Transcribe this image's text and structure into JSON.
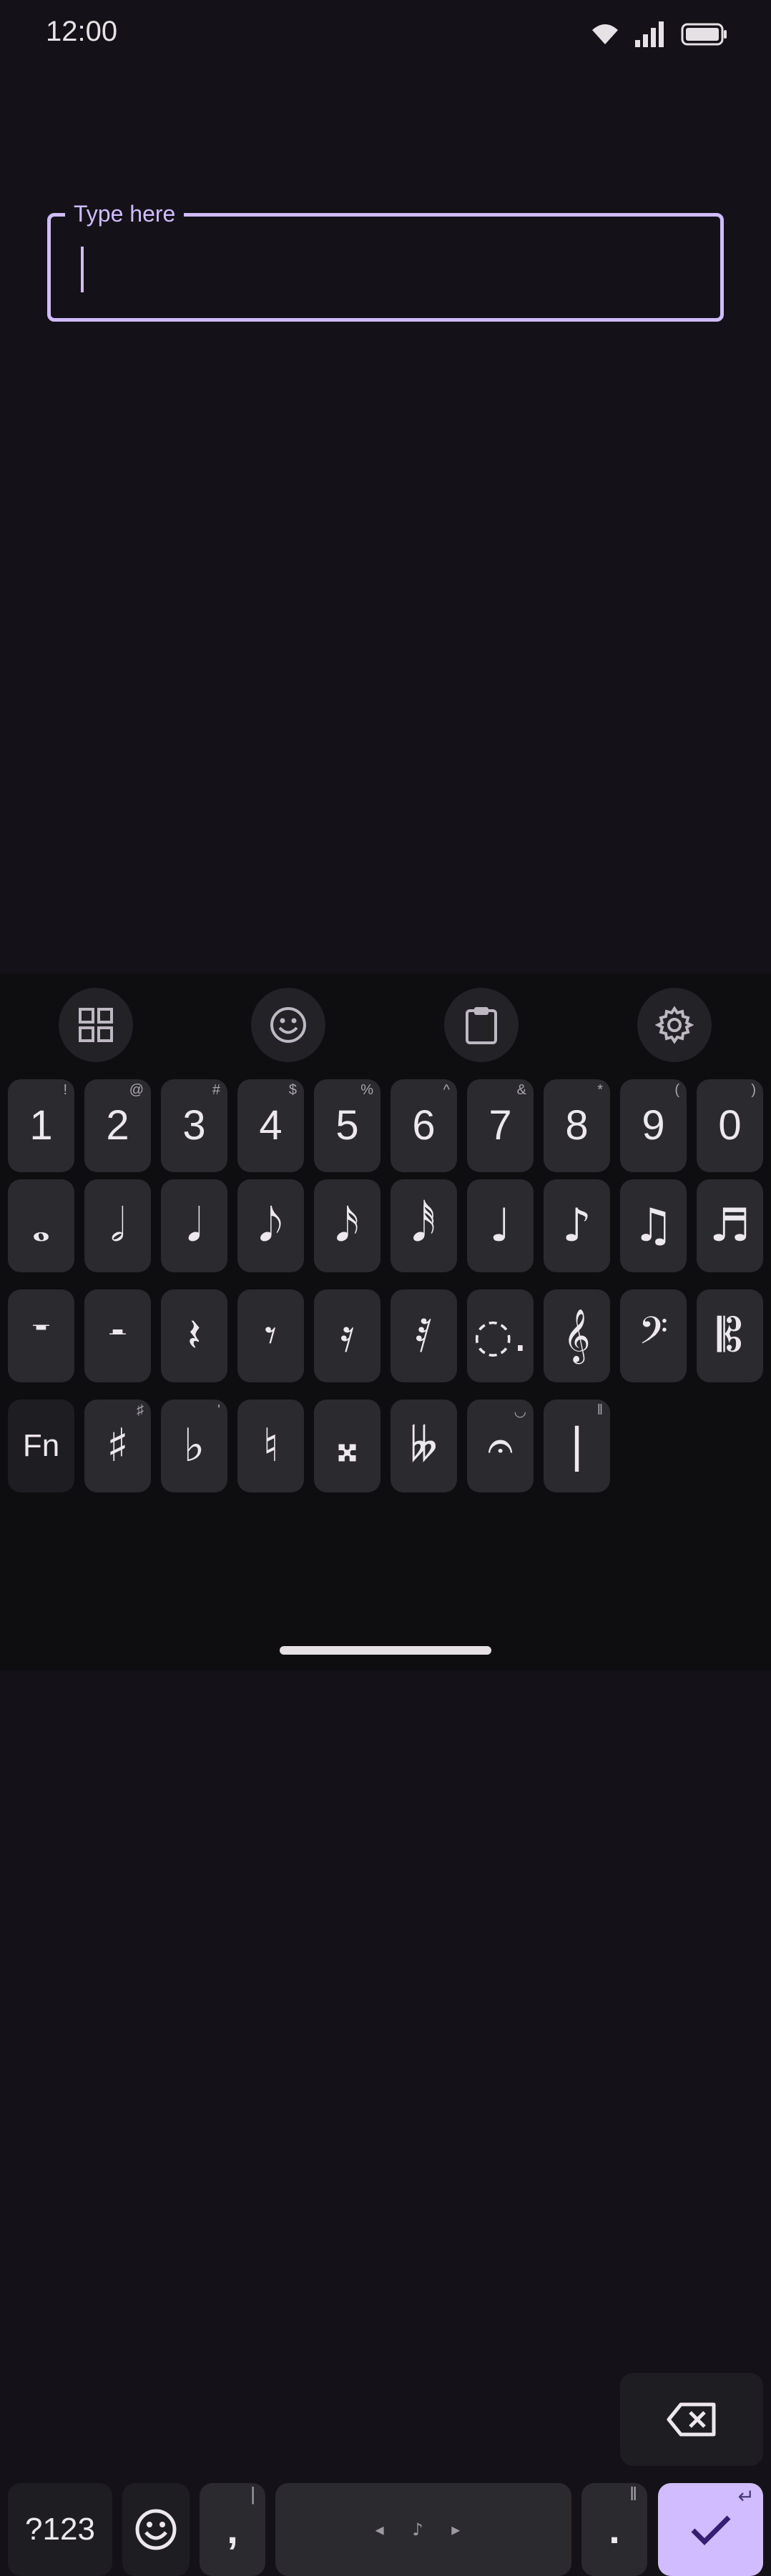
{
  "status_bar": {
    "time": "12:00"
  },
  "text_field": {
    "label": "Type here",
    "value": ""
  },
  "toolbar": [
    {
      "name": "apps-grid-icon"
    },
    {
      "name": "emoji-icon"
    },
    {
      "name": "clipboard-icon"
    },
    {
      "name": "settings-gear-icon"
    }
  ],
  "number_row": [
    {
      "main": "1",
      "hint": "!"
    },
    {
      "main": "2",
      "hint": "@"
    },
    {
      "main": "3",
      "hint": "#"
    },
    {
      "main": "4",
      "hint": "$"
    },
    {
      "main": "5",
      "hint": "%"
    },
    {
      "main": "6",
      "hint": "^"
    },
    {
      "main": "7",
      "hint": "&"
    },
    {
      "main": "8",
      "hint": "*"
    },
    {
      "main": "9",
      "hint": "("
    },
    {
      "main": "0",
      "hint": ")"
    }
  ],
  "note_row": [
    {
      "main": "𝅝"
    },
    {
      "main": "𝅗𝅥"
    },
    {
      "main": "𝅘𝅥"
    },
    {
      "main": "𝅘𝅥𝅮"
    },
    {
      "main": "𝅘𝅥𝅯"
    },
    {
      "main": "𝅘𝅥𝅰"
    },
    {
      "main": "♩"
    },
    {
      "main": "♪"
    },
    {
      "main": "♫"
    },
    {
      "main": "♬"
    }
  ],
  "rest_row": [
    {
      "main": "𝄻"
    },
    {
      "main": "𝄼"
    },
    {
      "main": "𝄽"
    },
    {
      "main": "𝄾"
    },
    {
      "main": "𝄿"
    },
    {
      "main": "𝅀"
    },
    {
      "main": "◌."
    },
    {
      "main": "𝄞"
    },
    {
      "main": "𝄢"
    },
    {
      "main": "𝄡"
    }
  ],
  "accidental_row": [
    {
      "main": "Fn",
      "hint": ""
    },
    {
      "main": "♯",
      "hint": "♯"
    },
    {
      "main": "♭",
      "hint": "'"
    },
    {
      "main": "♮",
      "hint": ""
    },
    {
      "main": "𝄪",
      "hint": ""
    },
    {
      "main": "𝄫",
      "hint": ""
    },
    {
      "main": "𝄐",
      "hint": "◡"
    },
    {
      "main": "|",
      "hint": "‖"
    }
  ],
  "bottom_row": {
    "symbols_label": "?123",
    "comma": ",",
    "comma_hint": "|",
    "space_hint": "◂ ♪ ▸",
    "period": ".",
    "period_hint": "‖",
    "enter_hint": "↵"
  },
  "colors": {
    "background": "#141218",
    "accent": "#d0bcff",
    "key": "#2b2a2e",
    "key_dark": "#1e1d21",
    "keyboard_bg": "#0e0d10"
  }
}
